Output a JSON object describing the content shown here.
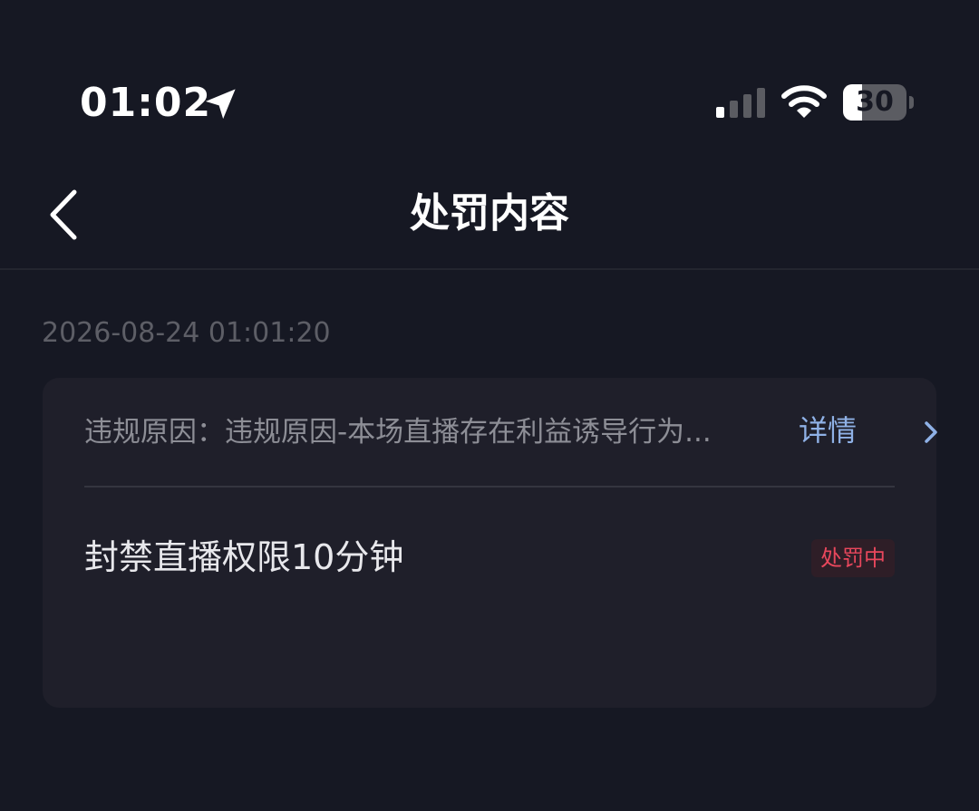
{
  "status_bar": {
    "time": "01:02",
    "location_icon": "location-arrow-icon",
    "signal_icon": "cellular-signal-icon",
    "signal_bars_active": 1,
    "signal_bars_total": 4,
    "wifi_icon": "wifi-icon",
    "battery_icon": "battery-icon",
    "battery_level": "30",
    "battery_fraction": 0.3
  },
  "nav": {
    "back_icon": "chevron-left-icon",
    "title": "处罚内容"
  },
  "record": {
    "timestamp": "2026-08-24 01:01:20",
    "reason": "违规原因：违规原因-本场直播存在利益诱导行为...",
    "detail_label": "详情",
    "detail_icon": "chevron-right-icon",
    "penalty": "封禁直播权限10分钟",
    "status": "处罚中"
  },
  "colors": {
    "background": "#161823",
    "card": "#1f1f2a",
    "detail_link": "#8fb1e6",
    "status_badge_text": "#e8475c",
    "status_badge_bg": "#2e1e27"
  }
}
